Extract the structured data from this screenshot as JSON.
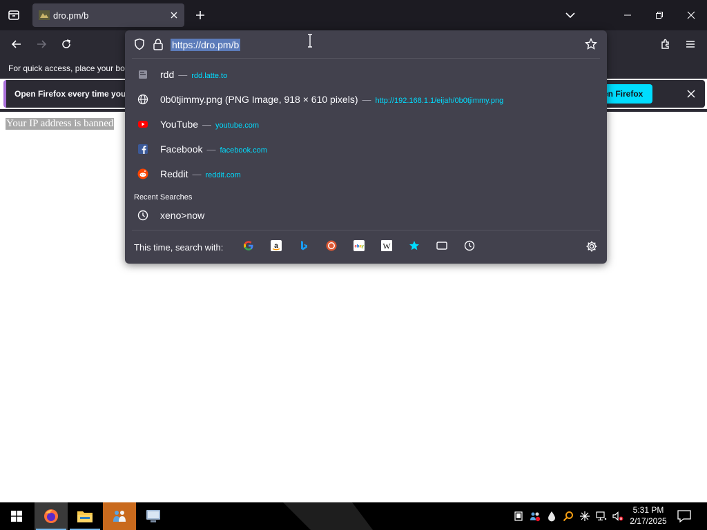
{
  "tab": {
    "title": "dro.pm/b"
  },
  "urlbar": {
    "url": "https://dro.pm/b"
  },
  "bookmarks_toolbar": {
    "text": "For quick access, place your boo"
  },
  "notification": {
    "message": "Open Firefox every time you",
    "action_label": "en Firefox"
  },
  "page": {
    "body_text": "Your IP address is banned"
  },
  "results": [
    {
      "title": "rdd",
      "url": "rdd.latte.to",
      "icon": "page-icon"
    },
    {
      "title": "0b0tjimmy.png (PNG Image, 918 × 610 pixels)",
      "url": "http://192.168.1.1/eijah/0b0tjimmy.png",
      "icon": "globe-icon"
    },
    {
      "title": "YouTube",
      "url": "youtube.com",
      "icon": "youtube-icon"
    },
    {
      "title": "Facebook",
      "url": "facebook.com",
      "icon": "facebook-icon"
    },
    {
      "title": "Reddit",
      "url": "reddit.com",
      "icon": "reddit-icon"
    }
  ],
  "recent_searches": {
    "label": "Recent Searches",
    "items": [
      {
        "text": "xeno>now"
      }
    ]
  },
  "search_with": {
    "label": "This time, search with:",
    "engines": [
      "google-icon",
      "amazon-icon",
      "bing-icon",
      "duckduckgo-icon",
      "ebay-icon",
      "wikipedia-icon",
      "bookmarks-icon",
      "tabs-icon",
      "history-icon"
    ]
  },
  "result_separator": "—",
  "taskbar": {
    "time": "5:31 PM",
    "date": "2/17/2025"
  },
  "colors": {
    "accent": "#00ddff",
    "panel": "#42414d",
    "toolbar": "#2b2a33",
    "tabstrip": "#1c1b22"
  }
}
